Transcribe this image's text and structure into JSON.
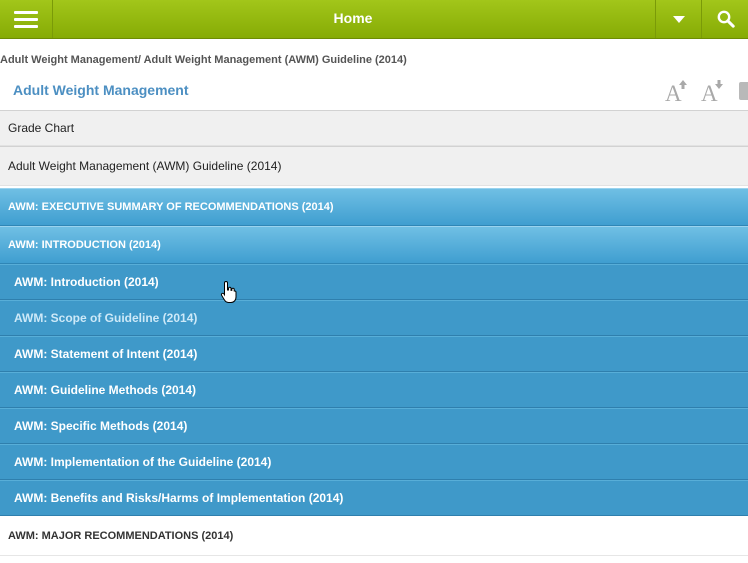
{
  "header": {
    "title": "Home",
    "menu_icon": "hamburger-icon",
    "dropdown_icon": "chevron-down-icon",
    "search_icon": "search-icon",
    "bg_color": "#93b80f"
  },
  "breadcrumb": "Adult Weight Management/ Adult Weight Management (AWM) Guideline (2014)",
  "page_title": "Adult Weight Management",
  "font_tools": [
    "font-increase-icon",
    "font-decrease-icon"
  ],
  "rows": {
    "grade_chart": "Grade Chart",
    "guideline": "Adult Weight Management (AWM) Guideline (2014)",
    "section_exec": "AWM: EXECUTIVE SUMMARY OF RECOMMENDATIONS (2014)",
    "section_intro": "AWM: INTRODUCTION (2014)",
    "sub_items": [
      "AWM: Introduction (2014)",
      "AWM: Scope of Guideline (2014)",
      "AWM: Statement of Intent (2014)",
      "AWM: Guideline Methods (2014)",
      "AWM: Specific Methods (2014)",
      "AWM: Implementation of the Guideline (2014)",
      "AWM: Benefits and Risks/Harms of Implementation (2014)"
    ],
    "section_major": "AWM: MAJOR RECOMMENDATIONS (2014)"
  },
  "colors": {
    "accent_blue": "#3f99c9",
    "title_blue": "#4c8fc2"
  }
}
